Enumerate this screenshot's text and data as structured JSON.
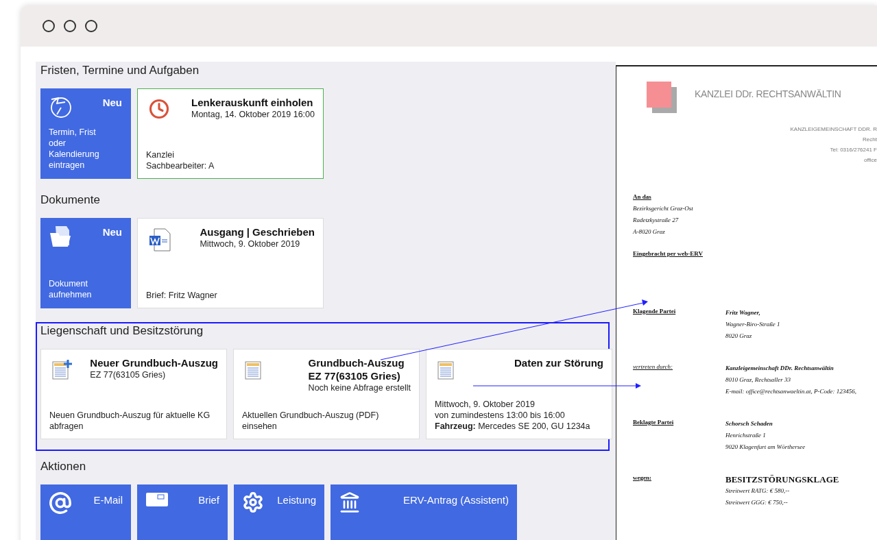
{
  "sections": [
    {
      "title": "Fristen, Termine und Aufgaben",
      "highlighted": false,
      "tiles": [
        {
          "kind": "new",
          "title": "Neu",
          "footer": [
            "Termin, Frist oder Kalendierung eintragen"
          ]
        },
        {
          "kind": "card",
          "selected": true,
          "title": [
            "Lenkerauskunft einholen"
          ],
          "subtitle": "Montag, 14. Oktober 2019 16:00",
          "footer": [
            "Kanzlei",
            "Sachbearbeiter: A"
          ]
        }
      ]
    },
    {
      "title": "Dokumente",
      "highlighted": false,
      "tiles": [
        {
          "kind": "new",
          "title": "Neu",
          "footer": [
            "Dokument aufnehmen"
          ]
        },
        {
          "kind": "card",
          "selected": false,
          "title": [
            "Ausgang | Geschrieben"
          ],
          "subtitle": "Mittwoch, 9. Oktober 2019",
          "footer": [
            "Brief: Fritz Wagner"
          ]
        }
      ]
    },
    {
      "title": "Liegenschaft und Besitzstörung",
      "highlighted": true,
      "tiles": [
        {
          "kind": "card",
          "selected": false,
          "title": [
            "Neuer Grundbuch-Auszug"
          ],
          "subtitle": "EZ 77(63105 Gries)",
          "footer": [
            "Neuen Grundbuch-Auszug für aktuelle KG abfragen"
          ]
        },
        {
          "kind": "card",
          "selected": false,
          "title": [
            "Grundbuch-Auszug",
            "EZ 77(63105 Gries)"
          ],
          "subtitle": "Noch keine Abfrage erstellt",
          "footer": [
            "Aktuellen Grundbuch-Auszug (PDF) einsehen"
          ]
        },
        {
          "kind": "card",
          "selected": false,
          "title": [
            "Daten zur Störung"
          ],
          "footer": [
            "Mittwoch, 9. Oktober 2019",
            "von zumindestens 13:00 bis 16:00",
            "**Fahrzeug:** Mercedes SE 200, GU 1234a"
          ]
        }
      ]
    },
    {
      "title": "Aktionen",
      "highlighted": false,
      "tiles": [
        {
          "kind": "action",
          "title": "E-Mail"
        },
        {
          "kind": "action",
          "title": "Brief"
        },
        {
          "kind": "action",
          "title": "Leistung"
        },
        {
          "kind": "action",
          "title": "ERV-Antrag (Assistent)"
        }
      ]
    }
  ],
  "document": {
    "letterhead": "KANZLEI  DDr. RECHTSANWÄLTIN",
    "sender": [
      "KANZLEIGEMEINSCHAFT DDR. R",
      "Recht",
      "Tel: 0316/276241 F",
      "office"
    ],
    "recipient_label": "An das",
    "recipient": [
      "Bezirksgericht Graz-Ost",
      "Radetzkystraße 27",
      "A-8020 Graz"
    ],
    "filing": "Eingebracht per web-ERV",
    "parties": [
      {
        "label": "Klagende Partei",
        "name": "Fritz Wagner,",
        "lines": [
          "Wagner-Biro-Straße 1",
          "8020 Graz"
        ]
      },
      {
        "label": "vertreten durch:",
        "name": "Kanzleigemeinschaft DDr. Rechtsanwältin",
        "lines": [
          "8010 Graz, Rechtsaller 33",
          "E-mail: office@rechtsanwaeltin.at, P-Code: 123456,"
        ]
      },
      {
        "label": "Beklagte Partei",
        "name": "Schorsch Schaden",
        "lines": [
          "Henrichstraße 1",
          "9020 Klagenfurt am Wörthersee"
        ]
      },
      {
        "label": "wegen:",
        "name": "BESITZSTÖRUNGSKLAGE",
        "lines": [
          "Streitwert RATG: € 580,--",
          "Streitwert GGG: € 750,--"
        ]
      }
    ]
  }
}
